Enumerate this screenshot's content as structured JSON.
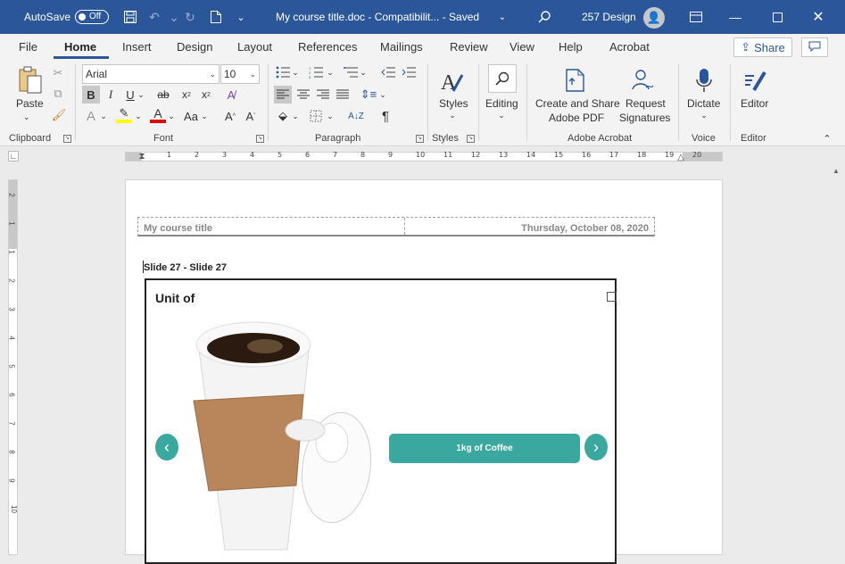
{
  "titlebar": {
    "autosave_label": "AutoSave",
    "autosave_state": "Off",
    "doc_title": "My course title.doc - Compatibilit... - Saved",
    "user_name": "257 Design"
  },
  "tabs": [
    "File",
    "Home",
    "Insert",
    "Design",
    "Layout",
    "References",
    "Mailings",
    "Review",
    "View",
    "Help",
    "Acrobat"
  ],
  "share_label": "Share",
  "ribbon": {
    "clipboard": {
      "paste": "Paste",
      "group": "Clipboard"
    },
    "font": {
      "name": "Arial",
      "size": "10",
      "group": "Font"
    },
    "paragraph": {
      "group": "Paragraph"
    },
    "styles": {
      "label": "Styles",
      "group": "Styles"
    },
    "editing": {
      "label": "Editing"
    },
    "acrobat": {
      "create_line1": "Create and Share",
      "create_line2": "Adobe PDF",
      "request_line1": "Request",
      "request_line2": "Signatures",
      "group": "Adobe Acrobat"
    },
    "voice": {
      "dictate": "Dictate",
      "group": "Voice"
    },
    "editor": {
      "label": "Editor",
      "group": "Editor"
    }
  },
  "ruler": {
    "h_numbers": [
      "1",
      "2",
      "3",
      "4",
      "5",
      "6",
      "7",
      "8",
      "9",
      "10",
      "11",
      "12",
      "13",
      "14",
      "15",
      "16",
      "17",
      "18",
      "19",
      "20"
    ],
    "v_numbers": [
      "2",
      "1",
      "1",
      "2",
      "3",
      "4",
      "5",
      "6",
      "7",
      "8",
      "9",
      "10"
    ]
  },
  "document": {
    "header_left": "My course title",
    "header_right": "Thursday, October 08, 2020",
    "slide_label": "Slide 27 - Slide 27",
    "unit_text": "Unit of",
    "answer_label": "1kg of Coffee"
  },
  "colors": {
    "word_blue": "#2b579a",
    "teal": "#3aa89e"
  }
}
